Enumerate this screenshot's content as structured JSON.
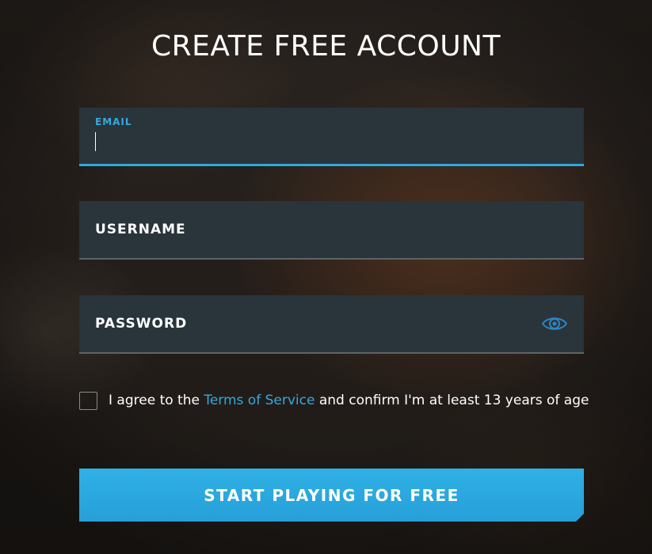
{
  "page": {
    "title": "CREATE FREE ACCOUNT"
  },
  "form": {
    "email": {
      "label": "EMAIL",
      "value": "",
      "focused": true
    },
    "username": {
      "label": "USERNAME",
      "value": ""
    },
    "password": {
      "label": "PASSWORD",
      "value": "",
      "toggle_icon": "eye-icon"
    },
    "agree": {
      "checked": false,
      "prefix": "I agree to the ",
      "link": "Terms of Service",
      "suffix": " and confirm I'm at least 13 years of age"
    },
    "submit_label": "START PLAYING FOR FREE"
  },
  "colors": {
    "accent": "#2da9e1",
    "field_bg": "#29343b",
    "text": "#ffffff"
  }
}
